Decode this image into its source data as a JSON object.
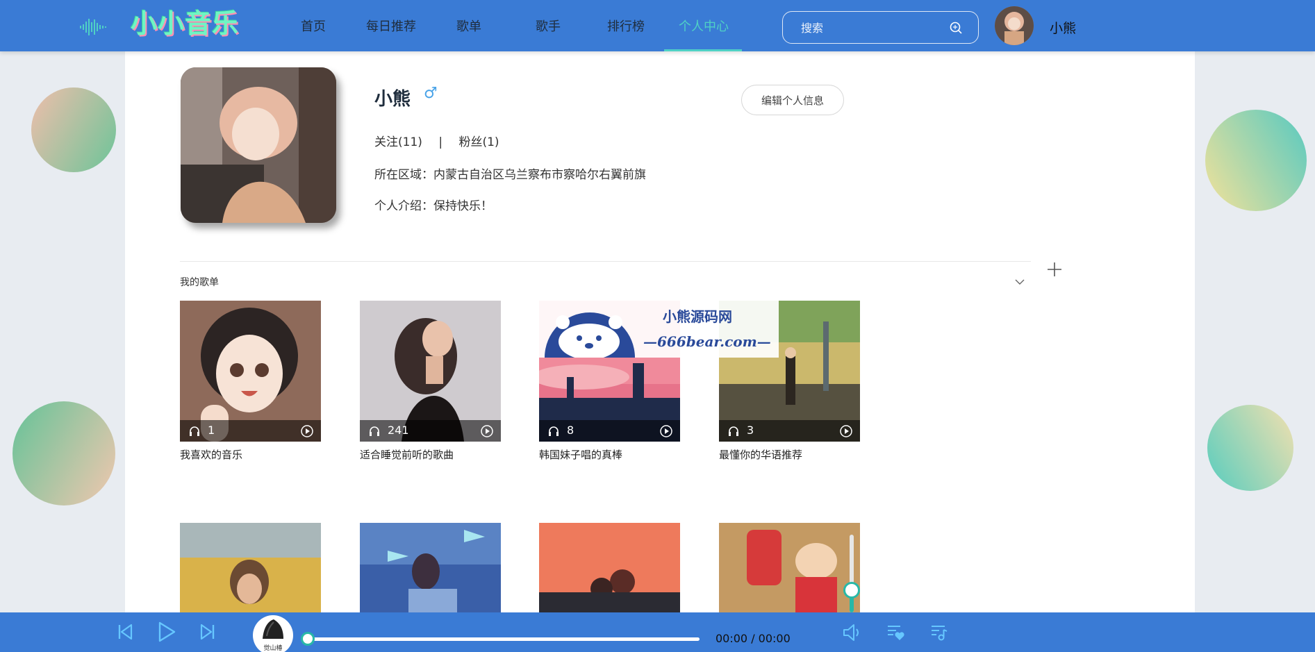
{
  "header": {
    "logo_text": "小小音乐",
    "nav": [
      {
        "label": "首页",
        "active": false
      },
      {
        "label": "每日推荐",
        "active": false
      },
      {
        "label": "歌单",
        "active": false
      },
      {
        "label": "歌手",
        "active": false
      },
      {
        "label": "排行榜",
        "active": false
      },
      {
        "label": "个人中心",
        "active": true
      }
    ],
    "search_placeholder": "搜索",
    "username": "小熊"
  },
  "profile": {
    "name": "小熊",
    "gender_symbol": "♂",
    "edit_button": "编辑个人信息",
    "follow": "关注(11)",
    "separator": "|",
    "fans": "粉丝(1)",
    "region": "所在区域：内蒙古自治区乌兰察布市察哈尔右翼前旗",
    "intro": "个人介绍：保持快乐！"
  },
  "playlists_section": {
    "title": "我的歌单",
    "items": [
      {
        "title": "我喜欢的音乐",
        "plays": "1"
      },
      {
        "title": "适合睡觉前听的歌曲",
        "plays": "241"
      },
      {
        "title": "韩国妹子唱的真棒",
        "plays": "8"
      },
      {
        "title": "最懂你的华语推荐",
        "plays": "3"
      }
    ]
  },
  "watermark": {
    "line1": "小熊源码网",
    "line2": "—666bear.com—"
  },
  "player": {
    "disc_label": "觉山椿",
    "time": "00:00 / 00:00",
    "progress": 0,
    "volume": 0.3
  },
  "colors": {
    "accent": "#3a7bd5",
    "active_nav": "#4fd1c5",
    "teal": "#28b8a7"
  }
}
